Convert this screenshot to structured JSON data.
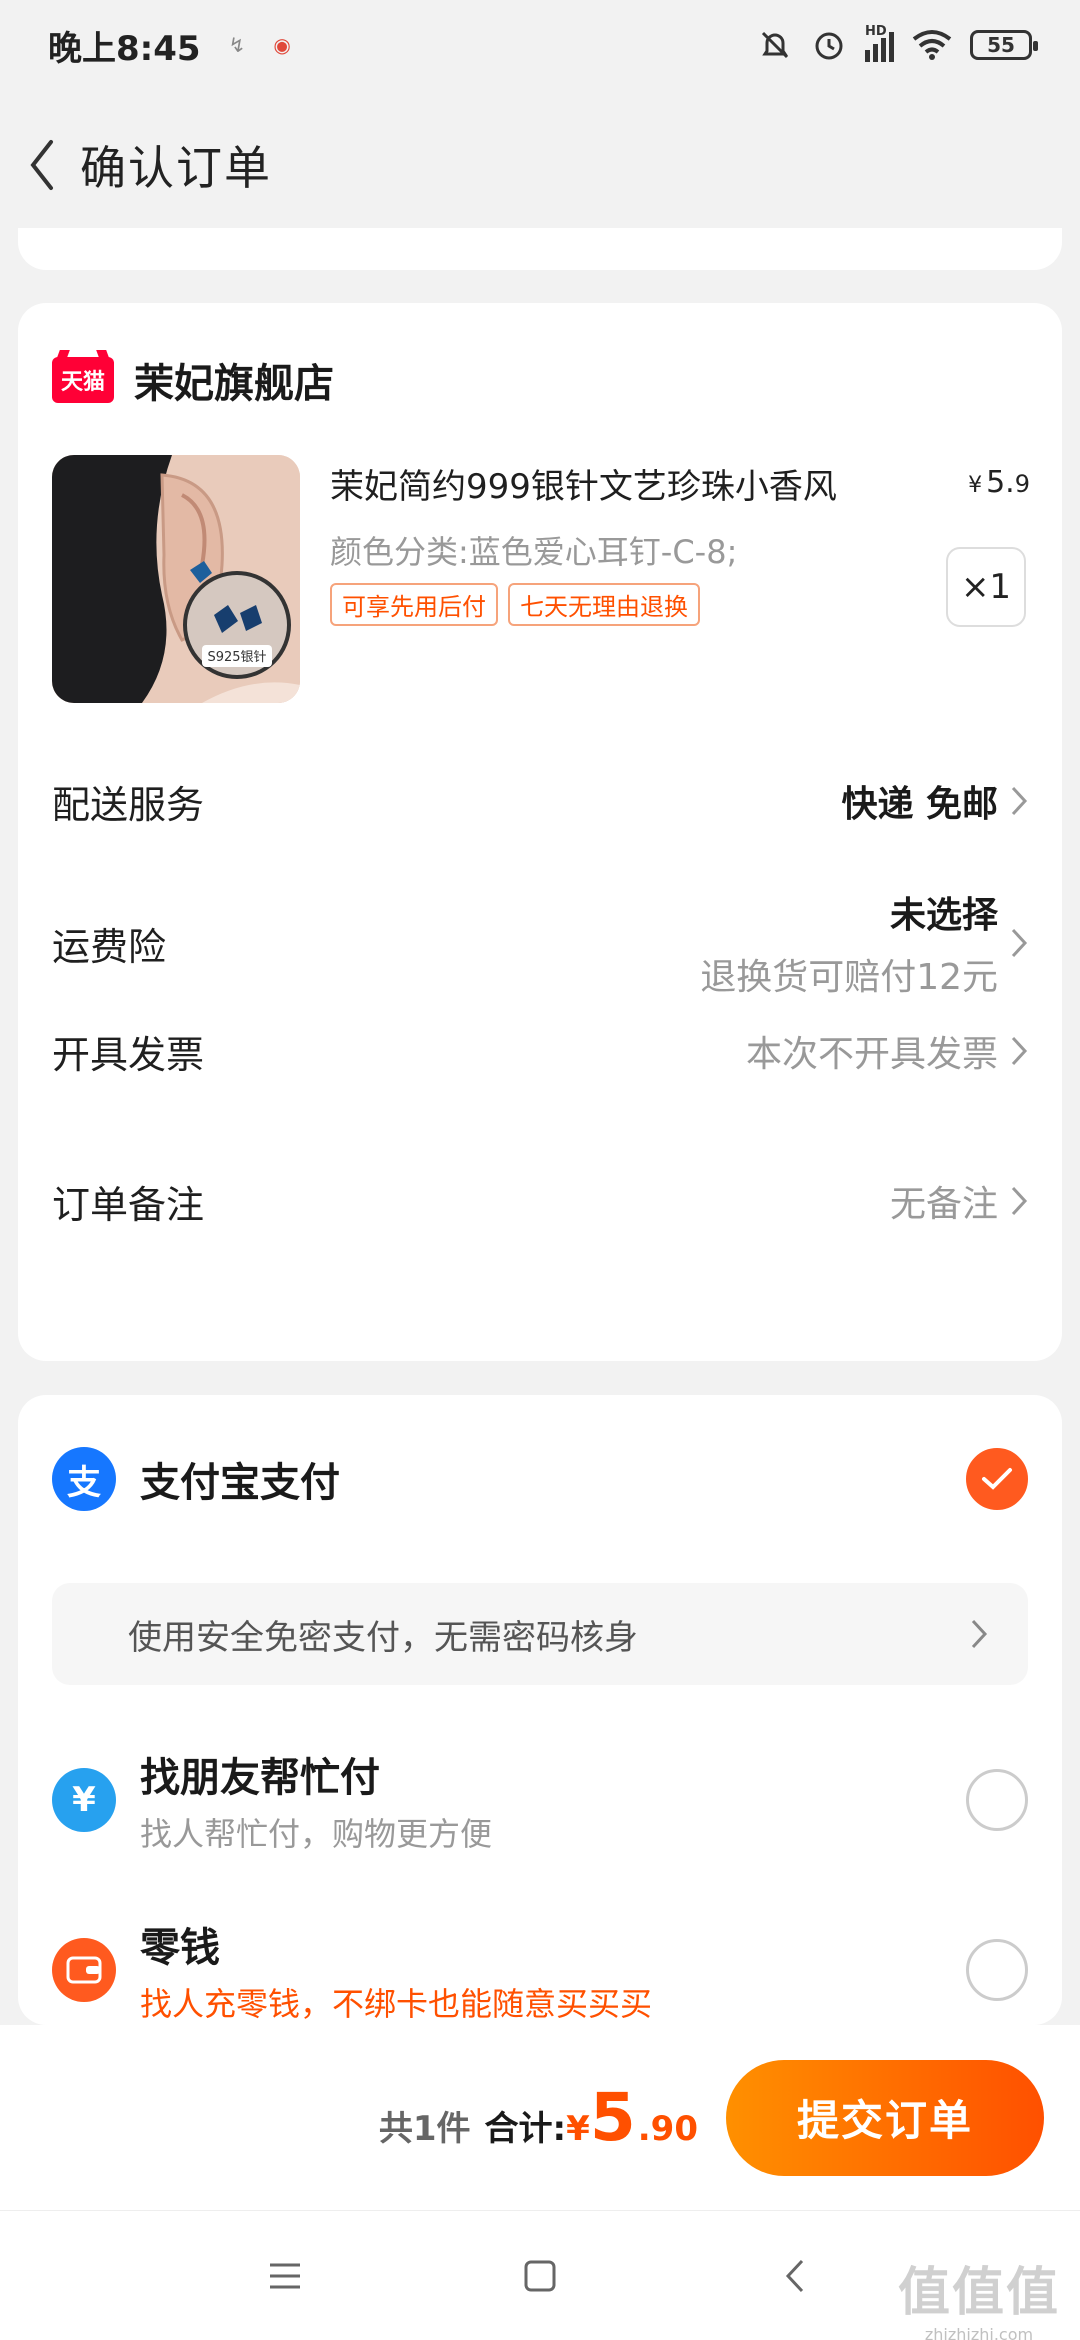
{
  "status_bar": {
    "time": "晚上8:45",
    "mini_icon_1": "↯",
    "mini_icon_2": "◉",
    "network_label": "HD",
    "battery": "55"
  },
  "nav": {
    "title": "确认订单"
  },
  "store": {
    "badge": "天猫",
    "name": "茉妃旗舰店"
  },
  "product": {
    "title": "茉妃简约999银针文艺珍珠小香风",
    "price_symbol": "¥",
    "price_int": "5.",
    "price_dec": "9",
    "spec": "颜色分类:蓝色爱心耳钉-C-8;",
    "tags": [
      "可享先用后付",
      "七天无理由退换"
    ],
    "quantity": "×1",
    "image_label": "S925银针"
  },
  "order_rows": {
    "delivery": {
      "label": "配送服务",
      "value": "快递 免邮"
    },
    "insurance": {
      "label": "运费险",
      "value": "未选择",
      "sub": "退换货可赔付12元"
    },
    "invoice": {
      "label": "开具发票",
      "value": "本次不开具发票"
    },
    "remark": {
      "label": "订单备注",
      "value": "无备注"
    }
  },
  "payment": {
    "alipay": {
      "icon_text": "支",
      "name": "支付宝支付",
      "selected": true
    },
    "secure_hint": "使用安全免密支付，无需密码核身",
    "friend": {
      "icon_text": "¥",
      "name": "找朋友帮忙付",
      "sub": "找人帮忙付，购物更方便"
    },
    "change": {
      "name": "零钱",
      "sub": "找人充零钱，不绑卡也能随意买买买"
    }
  },
  "bottom": {
    "count": "共1件",
    "sum_label": "合计:",
    "currency": "¥",
    "amount_int": "5",
    "amount_dec": ".90",
    "submit": "提交订单"
  },
  "watermark": {
    "logo": "值值值",
    "url": "zhizhizhi.com"
  },
  "colors": {
    "accent": "#ff5000",
    "tmall": "#ff0036",
    "alipay": "#1677ff"
  }
}
